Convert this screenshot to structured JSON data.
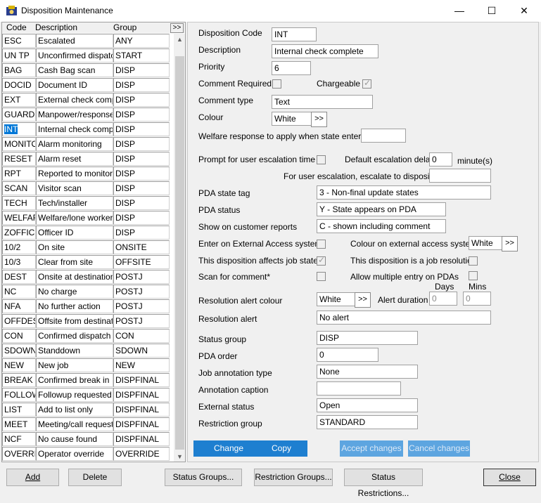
{
  "window": {
    "title": "Disposition Maintenance",
    "minimize": "—",
    "maximize": "☐",
    "close": "✕"
  },
  "grid": {
    "columns": [
      "Code",
      "Description",
      "Group"
    ],
    "more_button": ">>",
    "rows": [
      {
        "code": "ESC",
        "desc": "Escalated",
        "group": "ANY"
      },
      {
        "code": "UN TP",
        "desc": "Unconfirmed dispatch",
        "group": "START"
      },
      {
        "code": "BAG",
        "desc": "Cash Bag scan",
        "group": "DISP"
      },
      {
        "code": "DOCID",
        "desc": "Document ID",
        "group": "DISP"
      },
      {
        "code": "EXT",
        "desc": "External check complete",
        "group": "DISP"
      },
      {
        "code": "GUARD",
        "desc": "Manpower/response",
        "group": "DISP"
      },
      {
        "code": "INT",
        "desc": "Internal check complete",
        "group": "DISP",
        "selected": true
      },
      {
        "code": "MONITOR",
        "desc": "Alarm monitoring",
        "group": "DISP"
      },
      {
        "code": "RESET",
        "desc": "Alarm reset",
        "group": "DISP"
      },
      {
        "code": "RPT",
        "desc": "Reported to monitoring",
        "group": "DISP"
      },
      {
        "code": "SCAN",
        "desc": "Visitor scan",
        "group": "DISP"
      },
      {
        "code": "TECH",
        "desc": "Tech/installer",
        "group": "DISP"
      },
      {
        "code": "WELFARE",
        "desc": "Welfare/lone worker",
        "group": "DISP"
      },
      {
        "code": "ZOFFICE",
        "desc": "Officer ID",
        "group": "DISP"
      },
      {
        "code": "10/2",
        "desc": "On site",
        "group": "ONSITE"
      },
      {
        "code": "10/3",
        "desc": "Clear from site",
        "group": "OFFSITE"
      },
      {
        "code": "DEST",
        "desc": "Onsite at destination",
        "group": "POSTJ"
      },
      {
        "code": "NC",
        "desc": "No charge",
        "group": "POSTJ"
      },
      {
        "code": "NFA",
        "desc": "No further action",
        "group": "POSTJ"
      },
      {
        "code": "OFFDEST",
        "desc": "Offsite from destination",
        "group": "POSTJ"
      },
      {
        "code": "CON",
        "desc": "Confirmed dispatch",
        "group": "CON"
      },
      {
        "code": "SDOWN",
        "desc": "Standdown",
        "group": "SDOWN"
      },
      {
        "code": "NEW",
        "desc": "New job",
        "group": "NEW"
      },
      {
        "code": "BREAK",
        "desc": "Confirmed break in",
        "group": "DISPFINAL"
      },
      {
        "code": "FOLLOW",
        "desc": "Followup requested",
        "group": "DISPFINAL"
      },
      {
        "code": "LIST",
        "desc": "Add to list only",
        "group": "DISPFINAL"
      },
      {
        "code": "MEET",
        "desc": "Meeting/call requested",
        "group": "DISPFINAL"
      },
      {
        "code": "NCF",
        "desc": "No cause found",
        "group": "DISPFINAL"
      },
      {
        "code": "OVERRIDE",
        "desc": "Operator override",
        "group": "OVERRIDE"
      }
    ]
  },
  "form": {
    "disposition_code": {
      "label": "Disposition Code",
      "value": "INT"
    },
    "description": {
      "label": "Description",
      "value": "Internal check complete"
    },
    "priority": {
      "label": "Priority",
      "value": "6"
    },
    "comment_required": {
      "label": "Comment Required"
    },
    "chargeable": {
      "label": "Chargeable"
    },
    "comment_type": {
      "label": "Comment type",
      "value": "Text"
    },
    "colour": {
      "label": "Colour",
      "value": "White",
      "button": ">>"
    },
    "welfare": {
      "label": "Welfare response to apply when state entered",
      "value": ""
    },
    "prompt_escalation": {
      "label": "Prompt for user escalation time"
    },
    "default_delay": {
      "label": "Default escalation delay:",
      "value": "0",
      "unit": "minute(s)"
    },
    "escalate_to": {
      "label": "For user escalation, escalate to disposition",
      "value": ""
    },
    "pda_state_tag": {
      "label": "PDA state tag",
      "value": "3 - Non-final update states"
    },
    "pda_status": {
      "label": "PDA status",
      "value": "Y - State appears on PDA"
    },
    "customer_reports": {
      "label": "Show on customer reports",
      "value": "C - shown including comment"
    },
    "external_access": {
      "label": "Enter on External Access system"
    },
    "colour_external": {
      "label": "Colour on external access system",
      "value": "White",
      "button": ">>"
    },
    "affects_job_state": {
      "label": "This disposition affects job state"
    },
    "job_resolution": {
      "label": "This disposition is a job resolution"
    },
    "scan_for_comment": {
      "label": "Scan for comment*"
    },
    "multiple_entry": {
      "label": "Allow multiple entry on PDAs"
    },
    "days_header": "Days",
    "mins_header": "Mins",
    "resolution_alert_colour": {
      "label": "Resolution alert colour",
      "value": "White",
      "button": ">>"
    },
    "alert_duration": {
      "label": "Alert duration",
      "days": "0",
      "mins": "0"
    },
    "resolution_alert": {
      "label": "Resolution alert",
      "value": "No alert"
    },
    "status_group": {
      "label": "Status group",
      "value": "DISP"
    },
    "pda_order": {
      "label": "PDA order",
      "value": "0"
    },
    "job_annotation_type": {
      "label": "Job annotation type",
      "value": "None"
    },
    "annotation_caption": {
      "label": "Annotation caption",
      "value": ""
    },
    "external_status": {
      "label": "External status",
      "value": "Open"
    },
    "restriction_group": {
      "label": "Restriction group",
      "value": "STANDARD"
    }
  },
  "actions": {
    "change": "Change",
    "copy": "Copy",
    "accept": "Accept changes",
    "cancel": "Cancel changes"
  },
  "bottom": {
    "add": "Add",
    "delete": "Delete",
    "status_groups": "Status Groups...",
    "restriction_groups": "Restriction Groups...",
    "status_restrictions": "Status Restrictions...",
    "close": "Close"
  },
  "colors": {
    "accent": "#1e7fd0",
    "accent_disabled": "#5da5e0",
    "selection": "#0078d7"
  }
}
